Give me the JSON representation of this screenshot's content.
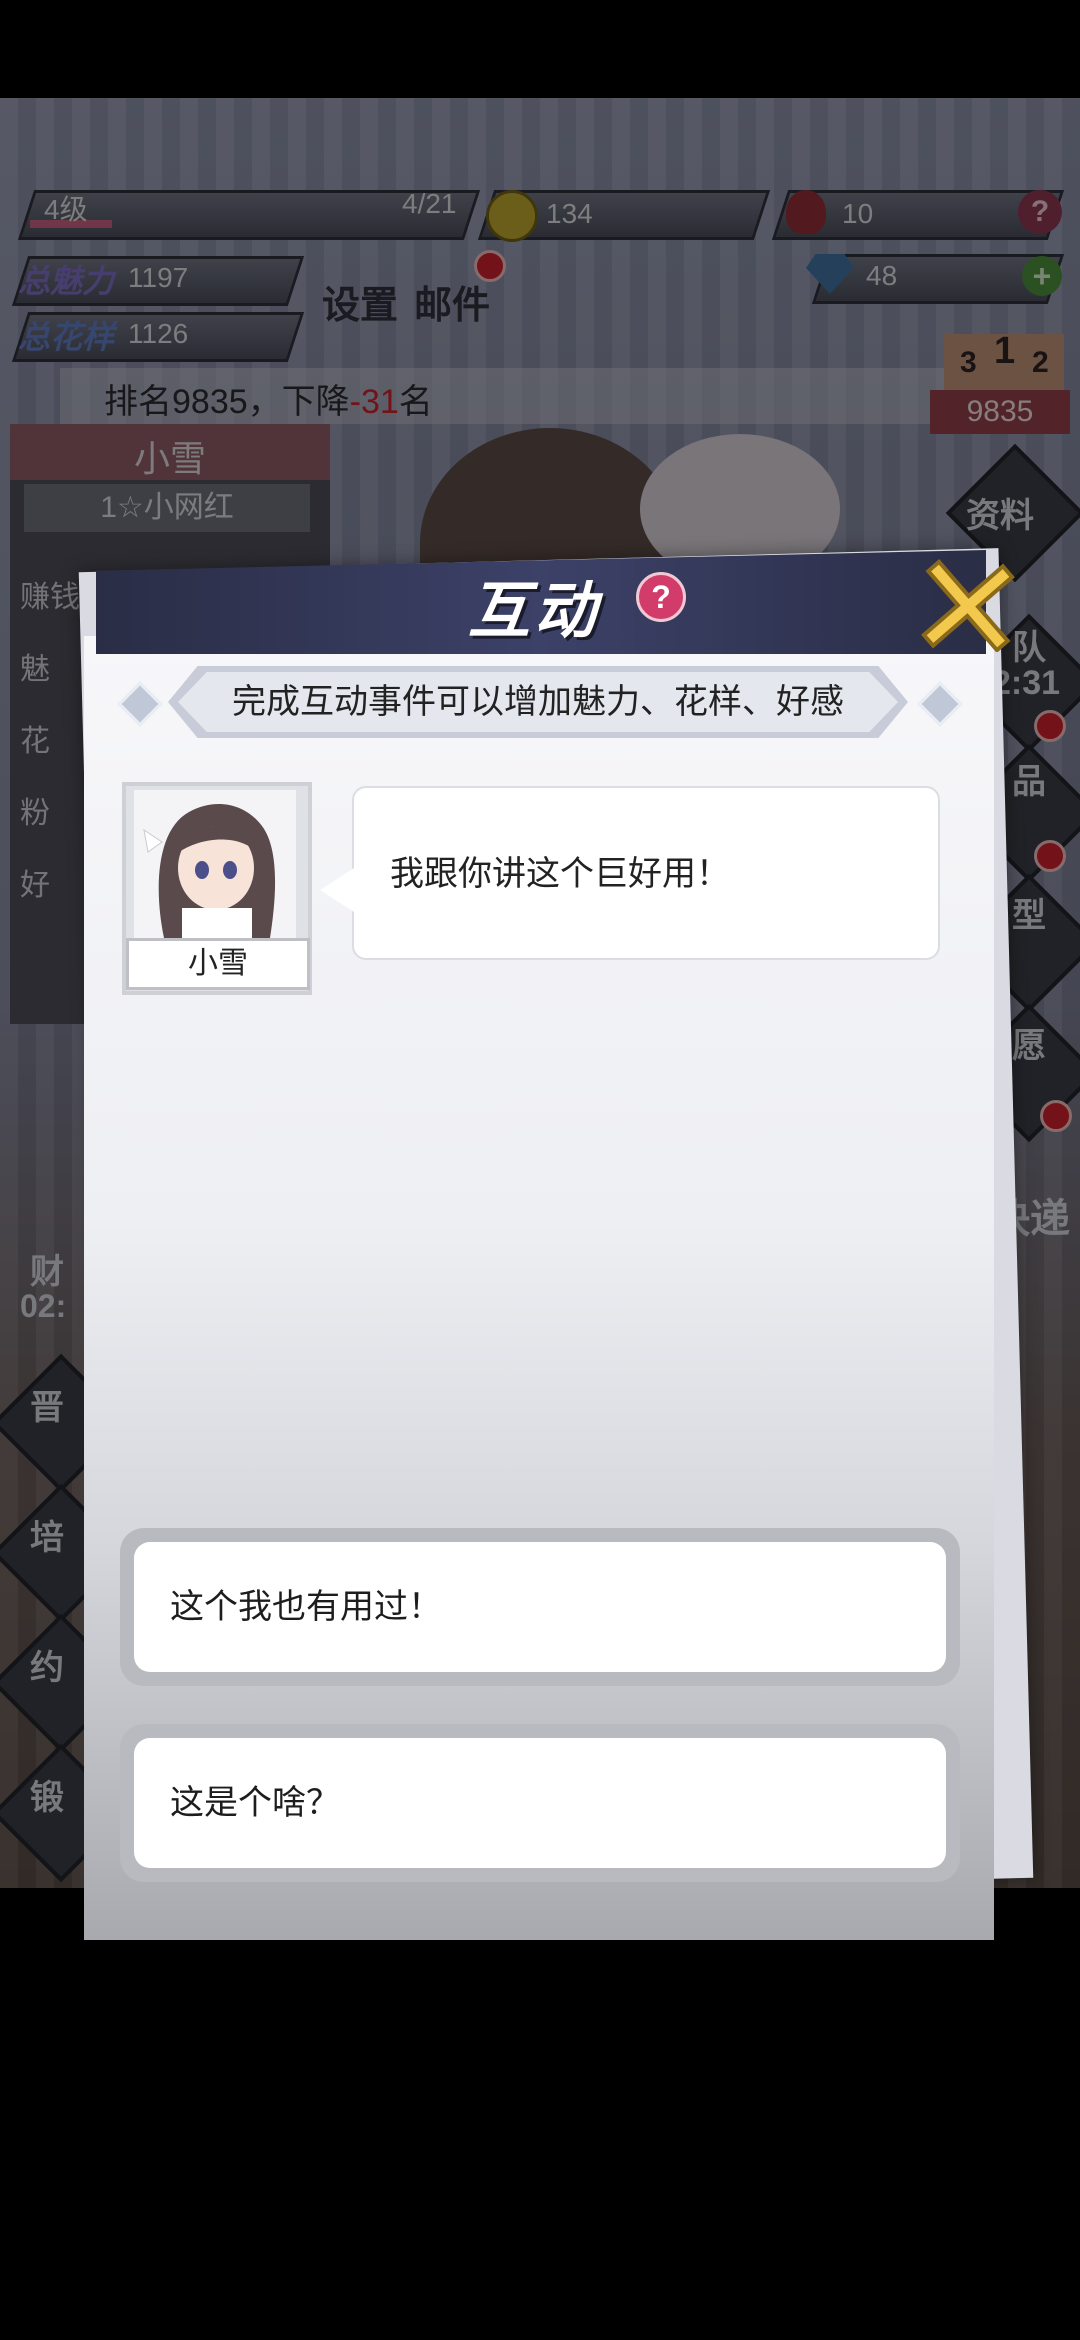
{
  "hud": {
    "level": "4级",
    "exp": "4/21",
    "exp_fraction": 0.19,
    "coins": "134",
    "roses": "10",
    "diamonds": "48",
    "total_charm_label": "总魅力",
    "total_charm": "1197",
    "total_style_label": "总花样",
    "total_style": "1126",
    "settings": "设置",
    "mail": "邮件",
    "rank_text_prefix": "排名9835，下降",
    "rank_drop": "-31",
    "rank_text_suffix": "名",
    "podium": [
      "3",
      "1",
      "2"
    ],
    "rank_value": "9835"
  },
  "character": {
    "name": "小雪",
    "title": "1☆小网红",
    "stats": [
      "赚钱",
      "魅",
      "花",
      "粉",
      "好"
    ]
  },
  "right_menu": [
    "资料",
    "队",
    "2:31",
    "品",
    "型",
    "愿",
    "快递"
  ],
  "left_menu": [
    "财",
    "02:",
    "晋",
    "培",
    "约",
    "锻"
  ],
  "dialog": {
    "title": "互动",
    "help": "?",
    "banner": "完成互动事件可以增加魅力、花样、好感",
    "speaker": "小雪",
    "message": "我跟你讲这个巨好用！",
    "options": [
      "这个我也有用过！",
      "这是个啥？"
    ]
  },
  "colors": {
    "header": "#2a2d45",
    "rank_drop": "#c8202c",
    "help_badge": "#d23c6a",
    "close_x": "#f2c94c"
  }
}
